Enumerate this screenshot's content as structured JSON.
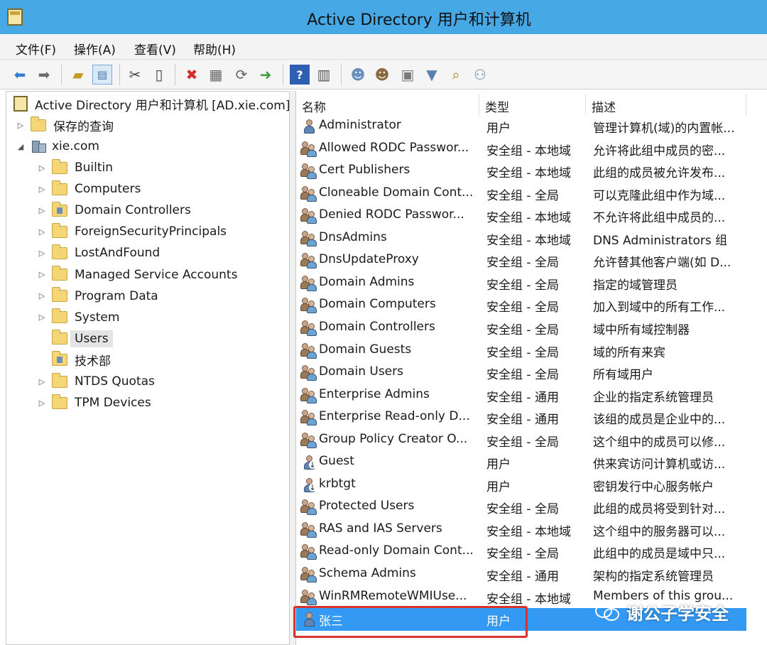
{
  "window": {
    "title": "Active Directory 用户和计算机"
  },
  "menu": [
    {
      "label": "文件(F)"
    },
    {
      "label": "操作(A)"
    },
    {
      "label": "查看(V)"
    },
    {
      "label": "帮助(H)"
    }
  ],
  "toolbar": {
    "buttons": [
      "back-icon",
      "forward-icon",
      "up-folder-icon",
      "console-tree-icon",
      "cut-icon",
      "copy-icon",
      "delete-icon",
      "properties-icon",
      "refresh-icon",
      "export-icon",
      "help-icon",
      "view-icon",
      "new-user-icon",
      "new-group-icon",
      "new-ou-icon",
      "filter-icon",
      "find-icon",
      "add-to-group-icon"
    ]
  },
  "tree": {
    "root": "Active Directory 用户和计算机 [AD.xie.com]",
    "saved_queries": "保存的查询",
    "domain": "xie.com",
    "children": [
      {
        "label": "Builtin",
        "expander": "▷",
        "special": false
      },
      {
        "label": "Computers",
        "expander": "▷",
        "special": false
      },
      {
        "label": "Domain Controllers",
        "expander": "▷",
        "special": true
      },
      {
        "label": "ForeignSecurityPrincipals",
        "expander": "▷",
        "special": false
      },
      {
        "label": "LostAndFound",
        "expander": "▷",
        "special": false
      },
      {
        "label": "Managed Service Accounts",
        "expander": "▷",
        "special": false
      },
      {
        "label": "Program Data",
        "expander": "▷",
        "special": false
      },
      {
        "label": "System",
        "expander": "▷",
        "special": false
      },
      {
        "label": "Users",
        "expander": "",
        "special": false,
        "selected": true
      },
      {
        "label": "技术部",
        "expander": "",
        "special": true
      },
      {
        "label": "NTDS Quotas",
        "expander": "▷",
        "special": false
      },
      {
        "label": "TPM Devices",
        "expander": "▷",
        "special": false
      }
    ]
  },
  "list": {
    "columns": [
      "名称",
      "类型",
      "描述"
    ],
    "rows": [
      {
        "icon": "user",
        "name": "Administrator",
        "type": "用户",
        "desc": "管理计算机(域)的内置帐..."
      },
      {
        "icon": "group",
        "name": "Allowed RODC Passwor...",
        "type": "安全组 - 本地域",
        "desc": "允许将此组中成员的密..."
      },
      {
        "icon": "group",
        "name": "Cert Publishers",
        "type": "安全组 - 本地域",
        "desc": "此组的成员被允许发布..."
      },
      {
        "icon": "group",
        "name": "Cloneable Domain Cont...",
        "type": "安全组 - 全局",
        "desc": "可以克隆此组中作为域..."
      },
      {
        "icon": "group",
        "name": "Denied RODC Passwor...",
        "type": "安全组 - 本地域",
        "desc": "不允许将此组中成员的..."
      },
      {
        "icon": "group",
        "name": "DnsAdmins",
        "type": "安全组 - 本地域",
        "desc": "DNS Administrators 组"
      },
      {
        "icon": "group",
        "name": "DnsUpdateProxy",
        "type": "安全组 - 全局",
        "desc": "允许替其他客户端(如 D..."
      },
      {
        "icon": "group",
        "name": "Domain Admins",
        "type": "安全组 - 全局",
        "desc": "指定的域管理员"
      },
      {
        "icon": "group",
        "name": "Domain Computers",
        "type": "安全组 - 全局",
        "desc": "加入到域中的所有工作..."
      },
      {
        "icon": "group",
        "name": "Domain Controllers",
        "type": "安全组 - 全局",
        "desc": "域中所有域控制器"
      },
      {
        "icon": "group",
        "name": "Domain Guests",
        "type": "安全组 - 全局",
        "desc": "域的所有来宾"
      },
      {
        "icon": "group",
        "name": "Domain Users",
        "type": "安全组 - 全局",
        "desc": "所有域用户"
      },
      {
        "icon": "group",
        "name": "Enterprise Admins",
        "type": "安全组 - 通用",
        "desc": "企业的指定系统管理员"
      },
      {
        "icon": "group",
        "name": "Enterprise Read-only D...",
        "type": "安全组 - 通用",
        "desc": "该组的成员是企业中的..."
      },
      {
        "icon": "group",
        "name": "Group Policy Creator O...",
        "type": "安全组 - 全局",
        "desc": "这个组中的成员可以修..."
      },
      {
        "icon": "user-disabled",
        "name": "Guest",
        "type": "用户",
        "desc": "供来宾访问计算机或访..."
      },
      {
        "icon": "user-disabled",
        "name": "krbtgt",
        "type": "用户",
        "desc": "密钥发行中心服务帐户"
      },
      {
        "icon": "group",
        "name": "Protected Users",
        "type": "安全组 - 全局",
        "desc": "此组的成员将受到针对..."
      },
      {
        "icon": "group",
        "name": "RAS and IAS Servers",
        "type": "安全组 - 本地域",
        "desc": "这个组中的服务器可以..."
      },
      {
        "icon": "group",
        "name": "Read-only Domain Cont...",
        "type": "安全组 - 全局",
        "desc": "此组中的成员是域中只..."
      },
      {
        "icon": "group",
        "name": "Schema Admins",
        "type": "安全组 - 通用",
        "desc": "架构的指定系统管理员"
      },
      {
        "icon": "group",
        "name": "WinRMRemoteWMIUse...",
        "type": "安全组 - 本地域",
        "desc": "Members of this grou..."
      },
      {
        "icon": "user",
        "name": "张三",
        "type": "用户",
        "desc": "",
        "selected": true
      }
    ]
  },
  "watermark": "谢公子学安全",
  "colors": {
    "titlebar": "#46a9e6",
    "selection": "#3399f3",
    "highlight": "#d9342b"
  }
}
